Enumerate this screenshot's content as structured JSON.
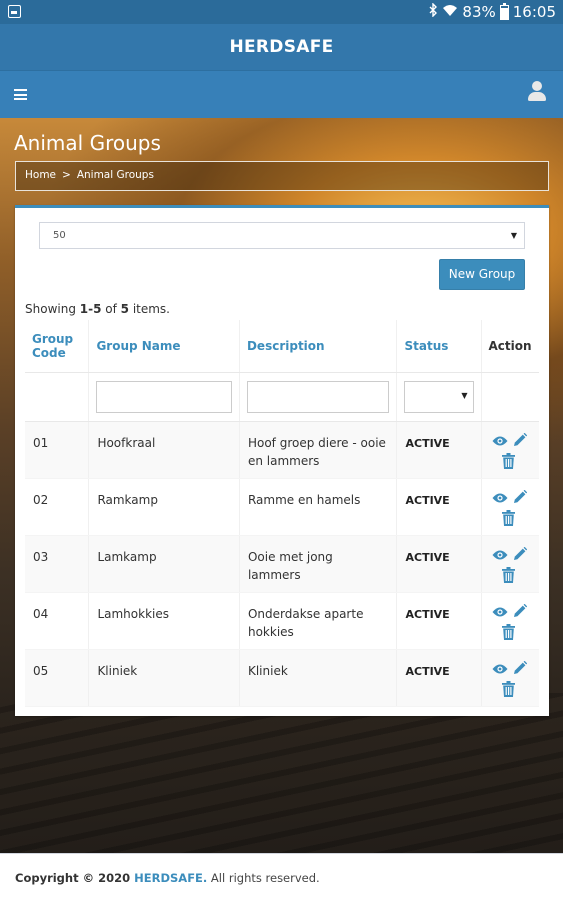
{
  "status_bar": {
    "battery": "83%",
    "time": "16:05"
  },
  "app_title": "HERDSAFE",
  "page_title": "Animal Groups",
  "breadcrumb": {
    "home": "Home",
    "separator": ">",
    "current": "Animal Groups"
  },
  "page_size": {
    "selected": "50"
  },
  "new_group_label": "New Group",
  "summary": {
    "prefix": "Showing ",
    "range": "1-5",
    "middle": " of ",
    "total": "5",
    "suffix": " items."
  },
  "table": {
    "columns": {
      "code": [
        "Group",
        "Code"
      ],
      "name": "Group Name",
      "description": "Description",
      "status": "Status",
      "action": "Action"
    },
    "rows": [
      {
        "code": "01",
        "name": "Hoofkraal",
        "description": "Hoof groep diere - ooie en lammers",
        "status": "ACTIVE"
      },
      {
        "code": "02",
        "name": "Ramkamp",
        "description": "Ramme en hamels",
        "status": "ACTIVE"
      },
      {
        "code": "03",
        "name": "Lamkamp",
        "description": "Ooie met jong lammers",
        "status": "ACTIVE"
      },
      {
        "code": "04",
        "name": "Lamhokkies",
        "description": "Onderdakse aparte hokkies",
        "status": "ACTIVE"
      },
      {
        "code": "05",
        "name": "Kliniek",
        "description": "Kliniek",
        "status": "ACTIVE"
      }
    ]
  },
  "footer": {
    "copyright": "Copyright © 2020 ",
    "brand": "HERDSAFE.",
    "rights": " All rights reserved."
  },
  "colors": {
    "appbar": "#3377ab",
    "navbar": "#3780b8",
    "accent": "#3c8dbc",
    "statusbar": "#2b6b9a"
  },
  "icons": [
    "image-icon",
    "bluetooth-icon",
    "wifi-icon",
    "battery-icon",
    "menu-icon",
    "user-icon",
    "eye-icon",
    "pencil-icon",
    "trash-icon"
  ]
}
